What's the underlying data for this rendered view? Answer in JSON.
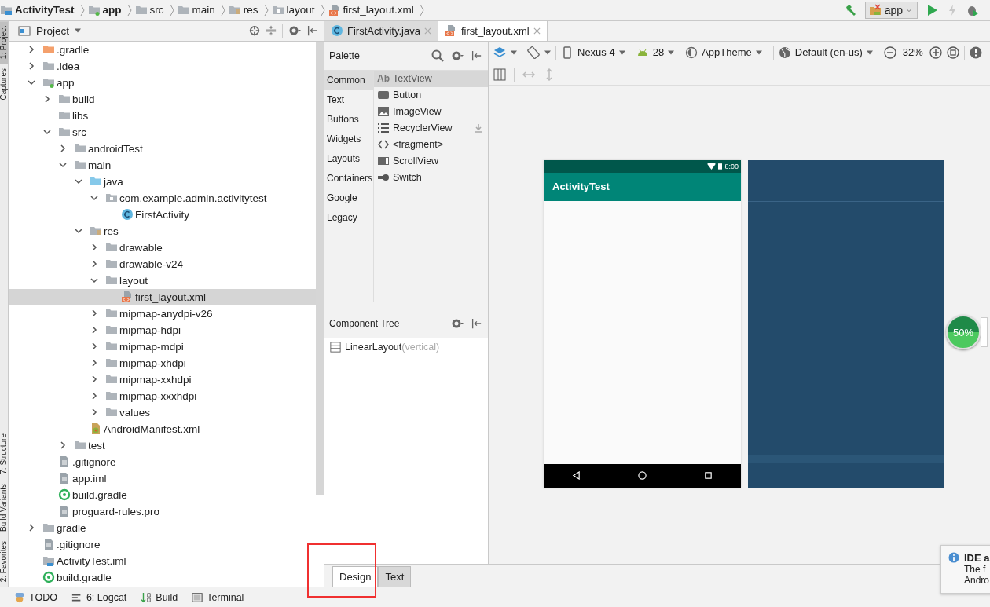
{
  "breadcrumbs": [
    {
      "label": "ActivityTest",
      "kind": "project",
      "bold": true
    },
    {
      "label": "app",
      "kind": "module",
      "bold": true
    },
    {
      "label": "src",
      "kind": "folder",
      "bold": false
    },
    {
      "label": "main",
      "kind": "folder",
      "bold": false
    },
    {
      "label": "res",
      "kind": "res",
      "bold": false
    },
    {
      "label": "layout",
      "kind": "package",
      "bold": false
    },
    {
      "label": "first_layout.xml",
      "kind": "xml",
      "bold": false
    }
  ],
  "run_toolbar": {
    "config": "app"
  },
  "side_tabs": [
    {
      "label": "1: Project",
      "selected": true
    },
    {
      "label": "Captures",
      "selected": false
    },
    {
      "label": "7: Structure",
      "selected": false
    },
    {
      "label": "Build Variants",
      "selected": false
    },
    {
      "label": "2: Favorites",
      "selected": false
    }
  ],
  "project_panel": {
    "title": "Project",
    "tree": [
      {
        "name": ".gradle",
        "kind": "folder-orange",
        "expanded": false,
        "selected": false
      },
      {
        "name": ".idea",
        "kind": "folder",
        "expanded": false,
        "selected": false
      },
      {
        "name": "app",
        "kind": "module",
        "expanded": true,
        "selected": false,
        "children": [
          {
            "name": "build",
            "kind": "folder",
            "expanded": false,
            "selected": false
          },
          {
            "name": "libs",
            "kind": "folder",
            "selected": false
          },
          {
            "name": "src",
            "kind": "folder",
            "expanded": true,
            "selected": false,
            "children": [
              {
                "name": "androidTest",
                "kind": "folder",
                "expanded": false,
                "selected": false
              },
              {
                "name": "main",
                "kind": "folder",
                "expanded": true,
                "selected": false,
                "children": [
                  {
                    "name": "java",
                    "kind": "folder-blue",
                    "expanded": true,
                    "selected": false,
                    "children": [
                      {
                        "name": "com.example.admin.activitytest",
                        "kind": "package",
                        "expanded": true,
                        "selected": false,
                        "children": [
                          {
                            "name": "FirstActivity",
                            "kind": "class",
                            "selected": false
                          }
                        ]
                      }
                    ]
                  },
                  {
                    "name": "res",
                    "kind": "res",
                    "expanded": true,
                    "selected": false,
                    "children": [
                      {
                        "name": "drawable",
                        "kind": "folder",
                        "expanded": false,
                        "selected": false
                      },
                      {
                        "name": "drawable-v24",
                        "kind": "folder",
                        "expanded": false,
                        "selected": false
                      },
                      {
                        "name": "layout",
                        "kind": "folder",
                        "expanded": true,
                        "selected": false,
                        "children": [
                          {
                            "name": "first_layout.xml",
                            "kind": "xml",
                            "selected": true
                          }
                        ]
                      },
                      {
                        "name": "mipmap-anydpi-v26",
                        "kind": "folder",
                        "expanded": false,
                        "selected": false
                      },
                      {
                        "name": "mipmap-hdpi",
                        "kind": "folder",
                        "expanded": false,
                        "selected": false
                      },
                      {
                        "name": "mipmap-mdpi",
                        "kind": "folder",
                        "expanded": false,
                        "selected": false
                      },
                      {
                        "name": "mipmap-xhdpi",
                        "kind": "folder",
                        "expanded": false,
                        "selected": false
                      },
                      {
                        "name": "mipmap-xxhdpi",
                        "kind": "folder",
                        "expanded": false,
                        "selected": false
                      },
                      {
                        "name": "mipmap-xxxhdpi",
                        "kind": "folder",
                        "expanded": false,
                        "selected": false
                      },
                      {
                        "name": "values",
                        "kind": "folder",
                        "expanded": false,
                        "selected": false
                      }
                    ]
                  },
                  {
                    "name": "AndroidManifest.xml",
                    "kind": "manifest",
                    "selected": false
                  }
                ]
              },
              {
                "name": "test",
                "kind": "folder",
                "expanded": false,
                "selected": false
              }
            ]
          },
          {
            "name": ".gitignore",
            "kind": "file",
            "selected": false
          },
          {
            "name": "app.iml",
            "kind": "file",
            "selected": false
          },
          {
            "name": "build.gradle",
            "kind": "gradle",
            "selected": false
          },
          {
            "name": "proguard-rules.pro",
            "kind": "file",
            "selected": false
          }
        ]
      },
      {
        "name": "gradle",
        "kind": "folder",
        "expanded": false,
        "selected": false
      },
      {
        "name": ".gitignore",
        "kind": "file",
        "selected": false
      },
      {
        "name": "ActivityTest.iml",
        "kind": "iml",
        "selected": false
      },
      {
        "name": "build.gradle",
        "kind": "gradle",
        "selected": false
      }
    ]
  },
  "editor_tabs": [
    {
      "label": "FirstActivity.java",
      "kind": "class",
      "selected": false
    },
    {
      "label": "first_layout.xml",
      "kind": "xml",
      "selected": true
    }
  ],
  "palette": {
    "title": "Palette",
    "categories": [
      {
        "label": "Common",
        "selected": true
      },
      {
        "label": "Text",
        "selected": false
      },
      {
        "label": "Buttons",
        "selected": false
      },
      {
        "label": "Widgets",
        "selected": false
      },
      {
        "label": "Layouts",
        "selected": false
      },
      {
        "label": "Containers",
        "selected": false
      },
      {
        "label": "Google",
        "selected": false
      },
      {
        "label": "Legacy",
        "selected": false
      }
    ],
    "items": [
      {
        "label": "TextView",
        "kind": "text",
        "glyph": "Ab",
        "selected": true,
        "downloadable": false
      },
      {
        "label": "Button",
        "kind": "button",
        "selected": false,
        "downloadable": false
      },
      {
        "label": "ImageView",
        "kind": "image",
        "selected": false,
        "downloadable": false
      },
      {
        "label": "RecyclerView",
        "kind": "list",
        "selected": false,
        "downloadable": true
      },
      {
        "label": "<fragment>",
        "kind": "code",
        "selected": false,
        "downloadable": false
      },
      {
        "label": "ScrollView",
        "kind": "scroll",
        "selected": false,
        "downloadable": false
      },
      {
        "label": "Switch",
        "kind": "switch",
        "selected": false,
        "downloadable": false
      }
    ]
  },
  "component_tree": {
    "title": "Component Tree",
    "items": [
      {
        "name": "LinearLayout",
        "detail": "(vertical)"
      }
    ]
  },
  "design_toolbar": {
    "device": "Nexus 4",
    "api": "28",
    "theme": "AppTheme",
    "locale": "Default (en-us)",
    "zoom": "32%"
  },
  "preview": {
    "time": "8:00",
    "app_title": "ActivityTest"
  },
  "mode_tabs": [
    {
      "label": "Design",
      "selected": true
    },
    {
      "label": "Text",
      "selected": false
    }
  ],
  "bottom_tools": [
    {
      "label": "TODO",
      "kind": "todo"
    },
    {
      "key": "6",
      "label": ": Logcat",
      "kind": "logcat"
    },
    {
      "label": "Build",
      "kind": "build"
    },
    {
      "label": "Terminal",
      "kind": "terminal"
    }
  ],
  "net_monitor": {
    "percent": "50%"
  },
  "notification": {
    "title": "IDE a",
    "lines": [
      "The f",
      "Andro"
    ]
  }
}
